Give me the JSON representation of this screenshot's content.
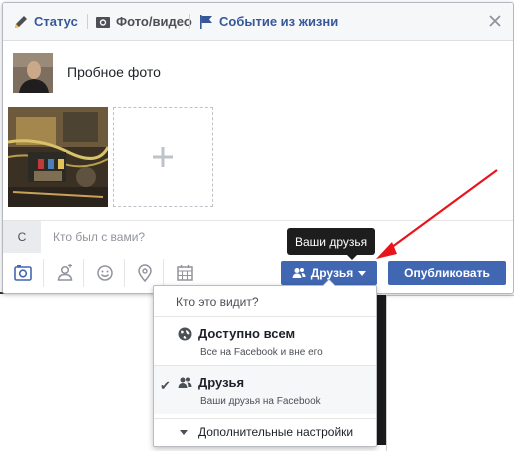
{
  "tabs": [
    {
      "label": "Статус",
      "icon": "pencil-icon"
    },
    {
      "label": "Фото/видео",
      "icon": "camera-icon"
    },
    {
      "label": "Событие из жизни",
      "icon": "flag-icon"
    }
  ],
  "composer": {
    "text": "Пробное фото"
  },
  "with": {
    "prefix": "С",
    "placeholder": "Кто был с вами?"
  },
  "footer": {
    "icons": [
      "camera-icon",
      "tag-person-icon",
      "smiley-icon",
      "location-pin-icon",
      "calendar-icon"
    ],
    "audience_button": "Друзья",
    "publish_button": "Опубликовать"
  },
  "tooltip": "Ваши друзья",
  "audience_menu": {
    "header": "Кто это видит?",
    "options": [
      {
        "title": "Доступно всем",
        "subtitle": "Все на Facebook и вне его",
        "icon": "globe-icon",
        "selected": false
      },
      {
        "title": "Друзья",
        "subtitle": "Ваши друзья на Facebook",
        "icon": "friends-icon",
        "selected": true
      }
    ],
    "more": "Дополнительные настройки"
  },
  "colors": {
    "brand": "#4267b2",
    "link": "#365899",
    "annotation_arrow": "#e8141c"
  }
}
